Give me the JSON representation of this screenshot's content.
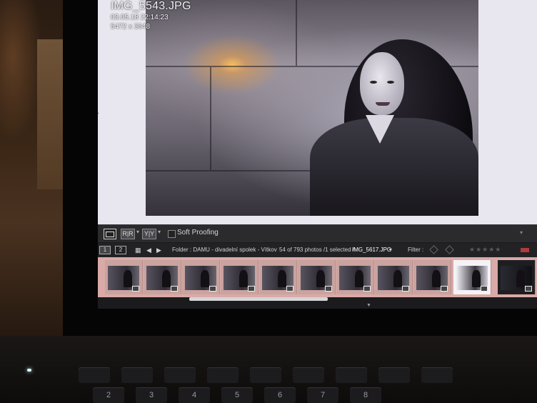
{
  "photo_info": {
    "filename": "IMG_5543.JPG",
    "datetime": "03.05.18 22:14:23",
    "dimensions": "5472 x 3648"
  },
  "toolbar": {
    "loupe_icon": "loupe-view-icon",
    "compare_label": "R|R",
    "survey_label": "Y|Y",
    "soft_proofing_label": "Soft Proofing",
    "soft_proofing_checked": false
  },
  "filmstrip_bar": {
    "page1": "1",
    "page2": "2",
    "grid_icon": "grid-icon",
    "folder_text": "Folder : DAMU - divadelní spolek - Vítkov",
    "count_text": "54 of 793 photos /1 selected /",
    "selected_file": "IMG_5617.JPG",
    "filter_label": "Filter :",
    "stars": "★★★★★"
  },
  "filmstrip": {
    "thumb_count": 11,
    "selected_index": 9,
    "scroll_fraction": 0.32
  },
  "keyboard": {
    "keys_row": [
      "",
      "",
      "",
      "",
      "",
      "",
      "",
      "",
      ""
    ],
    "keys_row2": [
      "",
      "2",
      "3",
      "4",
      "5",
      "6",
      "7",
      "8",
      ""
    ]
  },
  "colors": {
    "filmstrip_bg": "#d9aaa7",
    "toolbar_bg": "#2b2b2e",
    "preview_bg": "#e8e6ee"
  }
}
